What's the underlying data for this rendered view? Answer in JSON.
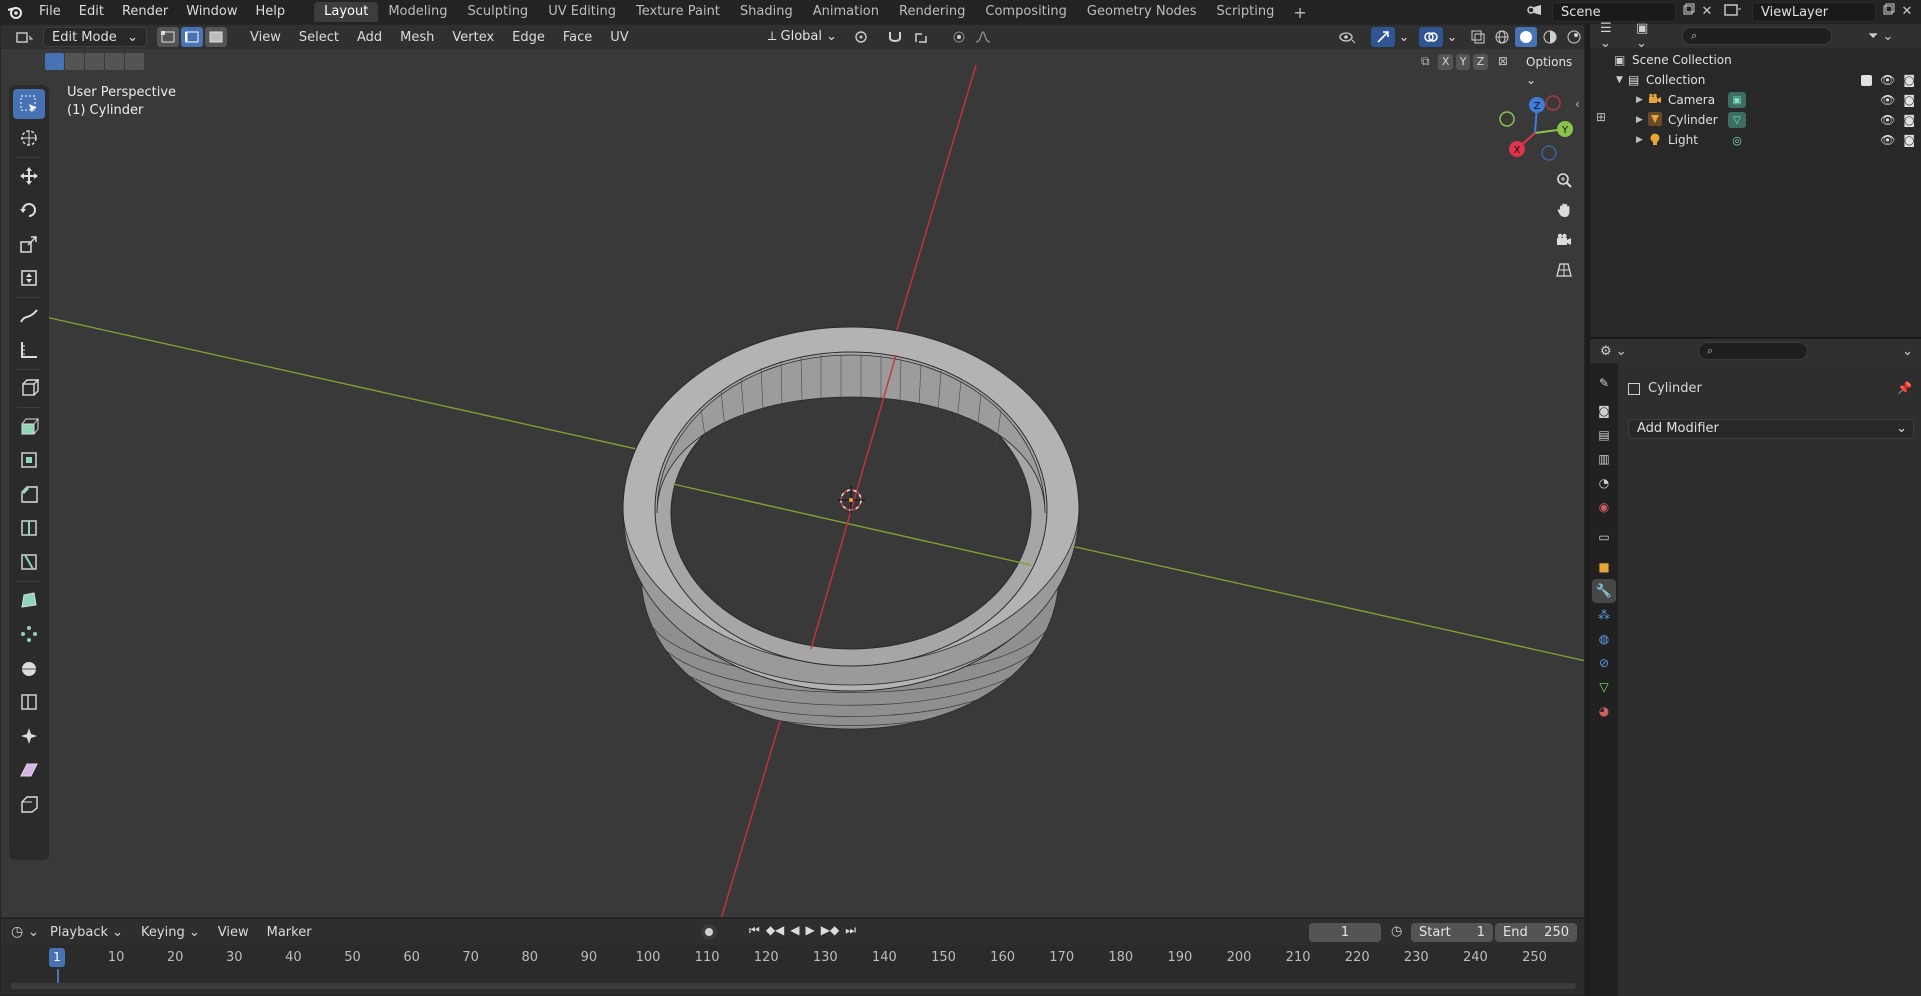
{
  "menu": {
    "items": [
      "File",
      "Edit",
      "Render",
      "Window",
      "Help"
    ]
  },
  "workspaces": {
    "tabs": [
      "Layout",
      "Modeling",
      "Sculpting",
      "UV Editing",
      "Texture Paint",
      "Shading",
      "Animation",
      "Rendering",
      "Compositing",
      "Geometry Nodes",
      "Scripting"
    ],
    "active": "Layout",
    "add": "+"
  },
  "scene": {
    "name": "Scene"
  },
  "view_layer": {
    "name": "ViewLayer"
  },
  "viewport_header": {
    "mode": "Edit Mode",
    "menus": [
      "View",
      "Select",
      "Add",
      "Mesh",
      "Vertex",
      "Edge",
      "Face",
      "UV"
    ],
    "orientation": "Global",
    "options_label": "Options",
    "axis_x": "X",
    "axis_y": "Y",
    "axis_z": "Z"
  },
  "viewport": {
    "perspective": "User Perspective",
    "object": "(1) Cylinder"
  },
  "gizmo": {
    "x": "X",
    "y": "Y",
    "z": "Z"
  },
  "timeline": {
    "menus": [
      "Playback",
      "Keying",
      "View",
      "Marker"
    ],
    "current_frame": "1",
    "start_label": "Start",
    "start_value": "1",
    "end_label": "End",
    "end_value": "250",
    "ticks": [
      "10",
      "20",
      "30",
      "40",
      "50",
      "60",
      "70",
      "80",
      "90",
      "100",
      "110",
      "120",
      "130",
      "140",
      "150",
      "160",
      "170",
      "180",
      "190",
      "200",
      "210",
      "220",
      "230",
      "240",
      "250"
    ],
    "cursor_label": "1"
  },
  "outliner": {
    "scene_collection": "Scene Collection",
    "collection": "Collection",
    "items": [
      {
        "name": "Camera",
        "color": "#e8a33a"
      },
      {
        "name": "Cylinder",
        "color": "#e8a33a"
      },
      {
        "name": "Light",
        "color": "#e8a33a"
      }
    ]
  },
  "properties": {
    "object_name": "Cylinder",
    "add_modifier": "Add Modifier"
  },
  "colors": {
    "accent": "#4772b3",
    "x_axis": "#e0344a",
    "y_axis": "#8bc34a",
    "z_axis": "#3f7bd9"
  }
}
